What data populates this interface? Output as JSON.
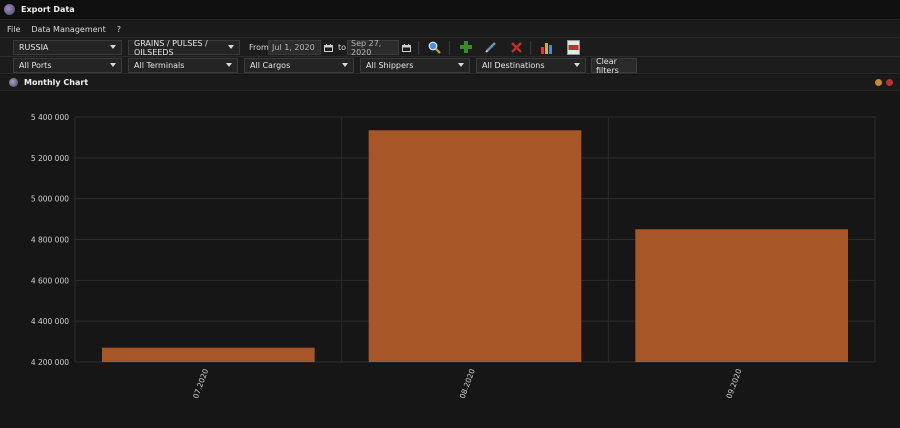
{
  "window": {
    "title": "Export Data"
  },
  "menu": [
    "File",
    "Data Management",
    "?"
  ],
  "filters": {
    "country": "RUSSIA",
    "commodity": "GRAINS / PULSES / OILSEEDS",
    "from_label": "From",
    "from_date": "Jul 1, 2020",
    "to_label": "to",
    "to_date": "Sep 27, 2020",
    "ports": "All Ports",
    "terminals": "All Terminals",
    "cargos": "All Cargos",
    "shippers": "All Shippers",
    "destinations": "All Destinations",
    "clear_label": "Clear filters"
  },
  "icons": {
    "search": "magnifier-icon",
    "add": "plus-icon",
    "edit": "pencil-icon",
    "delete": "x-icon",
    "chart": "bar-chart-icon",
    "export": "xls-export-icon"
  },
  "panel": {
    "title": "Monthly Chart"
  },
  "colors": {
    "bar": "#A65627",
    "min_dot": "#c98a2a",
    "close_dot": "#c03030"
  },
  "chart_data": {
    "type": "bar",
    "categories": [
      "07.2020",
      "08.2020",
      "09.2020"
    ],
    "values": [
      4270000,
      5335000,
      4850000
    ],
    "ylim": [
      4200000,
      5400000
    ],
    "yticks": [
      4200000,
      4400000,
      4600000,
      4800000,
      5000000,
      5200000,
      5400000
    ],
    "ytick_labels": [
      "4 200 000",
      "4 400 000",
      "4 600 000",
      "4 800 000",
      "5 000 000",
      "5 200 000",
      "5 400 000"
    ],
    "grid": true
  }
}
